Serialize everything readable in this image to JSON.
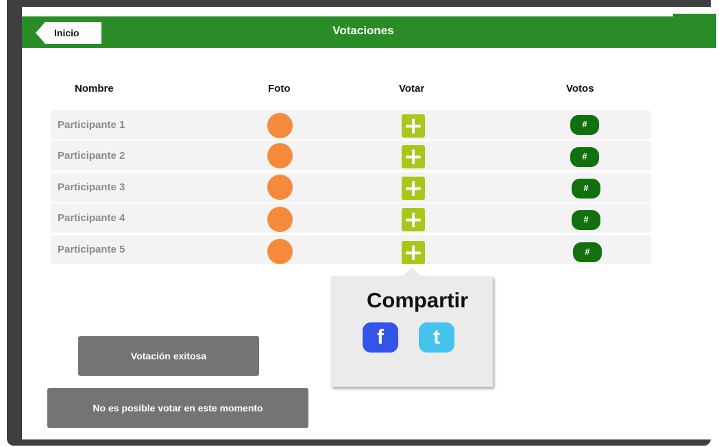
{
  "header": {
    "back_label": "Inicio",
    "title": "Votaciones"
  },
  "table": {
    "columns": [
      "Nombre",
      "Foto",
      "Votar",
      "Votos"
    ],
    "rows": [
      {
        "name": "Participante 1",
        "votes": "#"
      },
      {
        "name": "Participante 2",
        "votes": "#"
      },
      {
        "name": "Participante 3",
        "votes": "#"
      },
      {
        "name": "Participante 4",
        "votes": "#"
      },
      {
        "name": "Participante 5",
        "votes": "#"
      }
    ],
    "vote_symbol": "+"
  },
  "share_popup": {
    "title": "Compartir",
    "facebook_label": "f",
    "twitter_label": "t"
  },
  "messages": {
    "success": "Votación exitosa",
    "error": "No es posible votar en este momento"
  },
  "colors": {
    "header_green": "#2a8c27",
    "vote_button": "#a7c81a",
    "votes_badge": "#12700f",
    "photo_placeholder": "#f58a3c",
    "facebook": "#3354e8",
    "twitter": "#45c3ee",
    "message_button": "#747474"
  },
  "icons": {
    "back": "back-arrow-icon",
    "vote": "plus-icon",
    "facebook": "facebook-icon",
    "twitter": "twitter-icon"
  }
}
